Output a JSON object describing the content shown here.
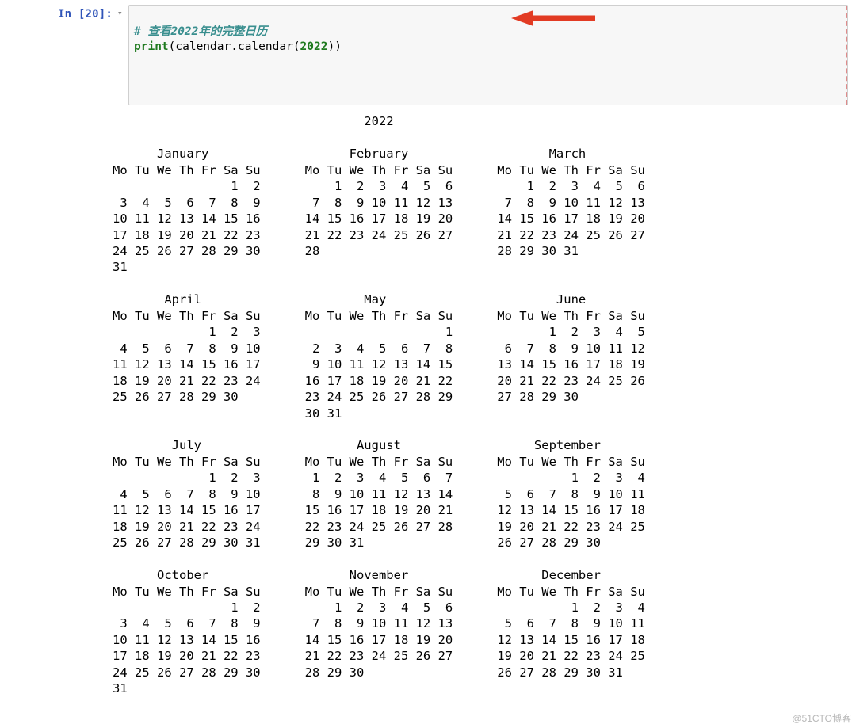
{
  "cell": {
    "prompt_label": "In [20]:",
    "code": {
      "comment": "# 查看2022年的完整日历",
      "line2_print": "print",
      "line2_open": "(",
      "line2_mod": "calendar",
      "line2_dot": ".",
      "line2_func": "calendar",
      "line2_open2": "(",
      "line2_arg": "2022",
      "line2_close2": ")",
      "line2_close": ")"
    }
  },
  "output": {
    "year": "2022",
    "dow": "Mo Tu We Th Fr Sa Su",
    "months": {
      "jan": {
        "name": "January",
        "rows": [
          "                1  2",
          " 3  4  5  6  7  8  9",
          "10 11 12 13 14 15 16",
          "17 18 19 20 21 22 23",
          "24 25 26 27 28 29 30",
          "31"
        ]
      },
      "feb": {
        "name": "February",
        "rows": [
          "    1  2  3  4  5  6",
          " 7  8  9 10 11 12 13",
          "14 15 16 17 18 19 20",
          "21 22 23 24 25 26 27",
          "28"
        ]
      },
      "mar": {
        "name": "March",
        "rows": [
          "    1  2  3  4  5  6",
          " 7  8  9 10 11 12 13",
          "14 15 16 17 18 19 20",
          "21 22 23 24 25 26 27",
          "28 29 30 31"
        ]
      },
      "apr": {
        "name": "April",
        "rows": [
          "             1  2  3",
          " 4  5  6  7  8  9 10",
          "11 12 13 14 15 16 17",
          "18 19 20 21 22 23 24",
          "25 26 27 28 29 30"
        ]
      },
      "may": {
        "name": "May",
        "rows": [
          "                   1",
          " 2  3  4  5  6  7  8",
          " 9 10 11 12 13 14 15",
          "16 17 18 19 20 21 22",
          "23 24 25 26 27 28 29",
          "30 31"
        ]
      },
      "jun": {
        "name": "June",
        "rows": [
          "       1  2  3  4  5",
          " 6  7  8  9 10 11 12",
          "13 14 15 16 17 18 19",
          "20 21 22 23 24 25 26",
          "27 28 29 30"
        ]
      },
      "jul": {
        "name": "July",
        "rows": [
          "             1  2  3",
          " 4  5  6  7  8  9 10",
          "11 12 13 14 15 16 17",
          "18 19 20 21 22 23 24",
          "25 26 27 28 29 30 31"
        ]
      },
      "aug": {
        "name": "August",
        "rows": [
          " 1  2  3  4  5  6  7",
          " 8  9 10 11 12 13 14",
          "15 16 17 18 19 20 21",
          "22 23 24 25 26 27 28",
          "29 30 31"
        ]
      },
      "sep": {
        "name": "September",
        "rows": [
          "          1  2  3  4",
          " 5  6  7  8  9 10 11",
          "12 13 14 15 16 17 18",
          "19 20 21 22 23 24 25",
          "26 27 28 29 30"
        ]
      },
      "oct": {
        "name": "October",
        "rows": [
          "                1  2",
          " 3  4  5  6  7  8  9",
          "10 11 12 13 14 15 16",
          "17 18 19 20 21 22 23",
          "24 25 26 27 28 29 30",
          "31"
        ]
      },
      "nov": {
        "name": "November",
        "rows": [
          "    1  2  3  4  5  6",
          " 7  8  9 10 11 12 13",
          "14 15 16 17 18 19 20",
          "21 22 23 24 25 26 27",
          "28 29 30"
        ]
      },
      "dec": {
        "name": "December",
        "rows": [
          "          1  2  3  4",
          " 5  6  7  8  9 10 11",
          "12 13 14 15 16 17 18",
          "19 20 21 22 23 24 25",
          "26 27 28 29 30 31"
        ]
      }
    }
  },
  "watermark_text": "@51CTO博客"
}
